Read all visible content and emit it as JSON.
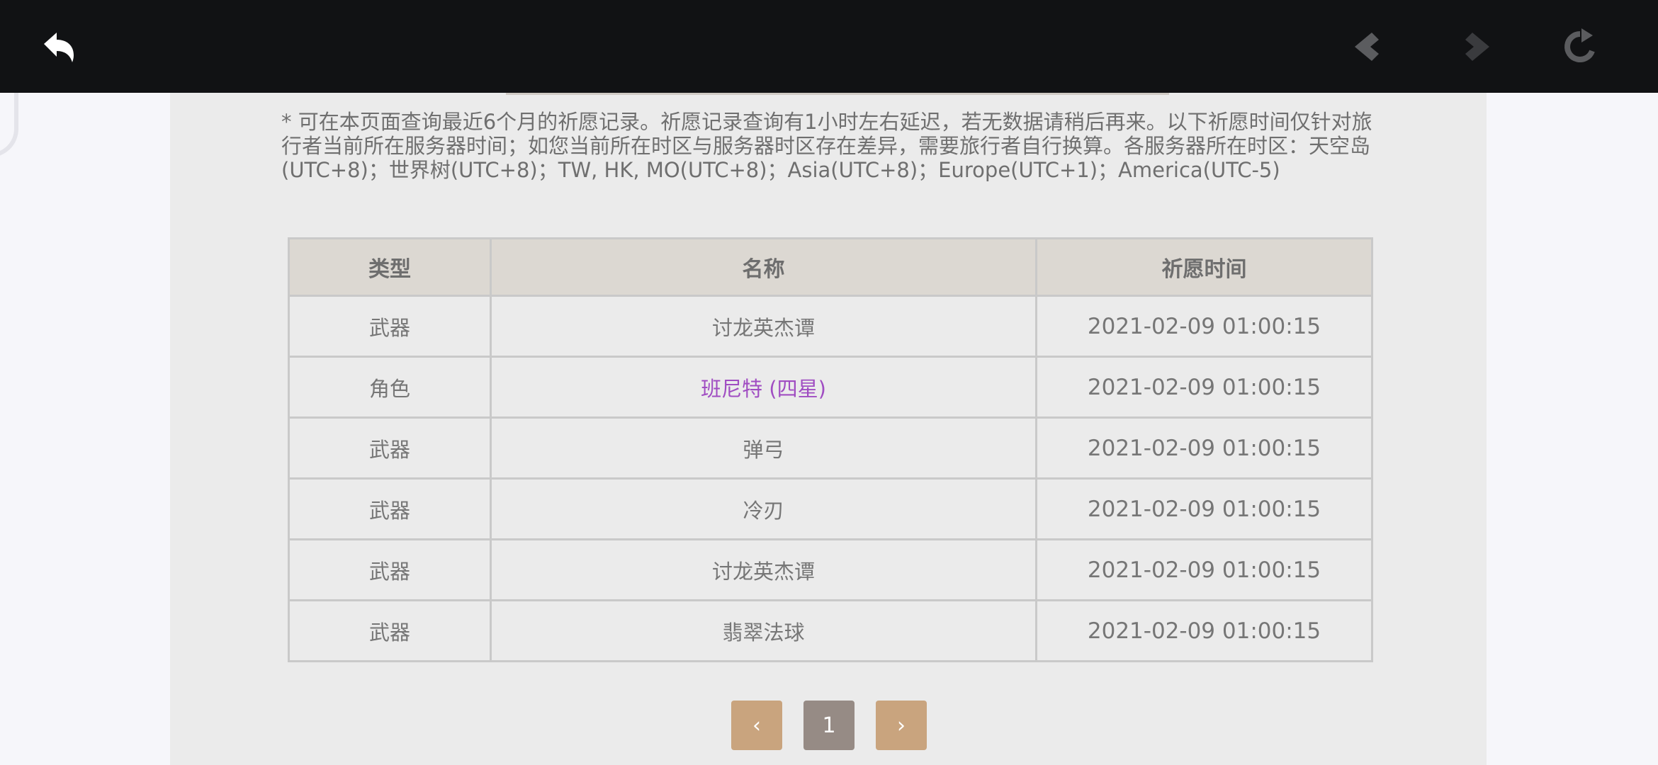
{
  "topbar": {
    "back_icon": "undo-arrow-icon",
    "nav_back_icon": "diamond-back-icon",
    "nav_forward_icon": "diamond-forward-icon",
    "reload_icon": "reload-icon",
    "bg_color": "#111214"
  },
  "notice": "* 可在本页面查询最近6个月的祈愿记录。祈愿记录查询有1小时左右延迟，若无数据请稍后再来。以下祈愿时间仅针对旅行者当前所在服务器时间；如您当前所在时区与服务器时区存在差异，需要旅行者自行换算。各服务器所在时区：天空岛(UTC+8)；世界树(UTC+8)；TW, HK, MO(UTC+8)；Asia(UTC+8)；Europe(UTC+1)；America(UTC-5)",
  "table": {
    "headers": [
      "类型",
      "名称",
      "祈愿时间"
    ],
    "rows": [
      {
        "type": "武器",
        "name": "讨龙英杰谭",
        "time": "2021-02-09 01:00:15"
      },
      {
        "type": "角色",
        "name": "班尼特 (四星)",
        "time": "2021-02-09 01:00:15"
      },
      {
        "type": "武器",
        "name": "弹弓",
        "time": "2021-02-09 01:00:15"
      },
      {
        "type": "武器",
        "name": "冷刃",
        "time": "2021-02-09 01:00:15"
      },
      {
        "type": "武器",
        "name": "讨龙英杰谭",
        "time": "2021-02-09 01:00:15"
      },
      {
        "type": "武器",
        "name": "翡翠法球",
        "time": "2021-02-09 01:00:15"
      }
    ]
  },
  "pagination": {
    "prev_label": "‹",
    "current_page": "1",
    "next_label": "›"
  },
  "colors": {
    "four_star": "#a04dc2",
    "pager_arrow": "#c9a47e",
    "pager_current": "#968b85"
  }
}
